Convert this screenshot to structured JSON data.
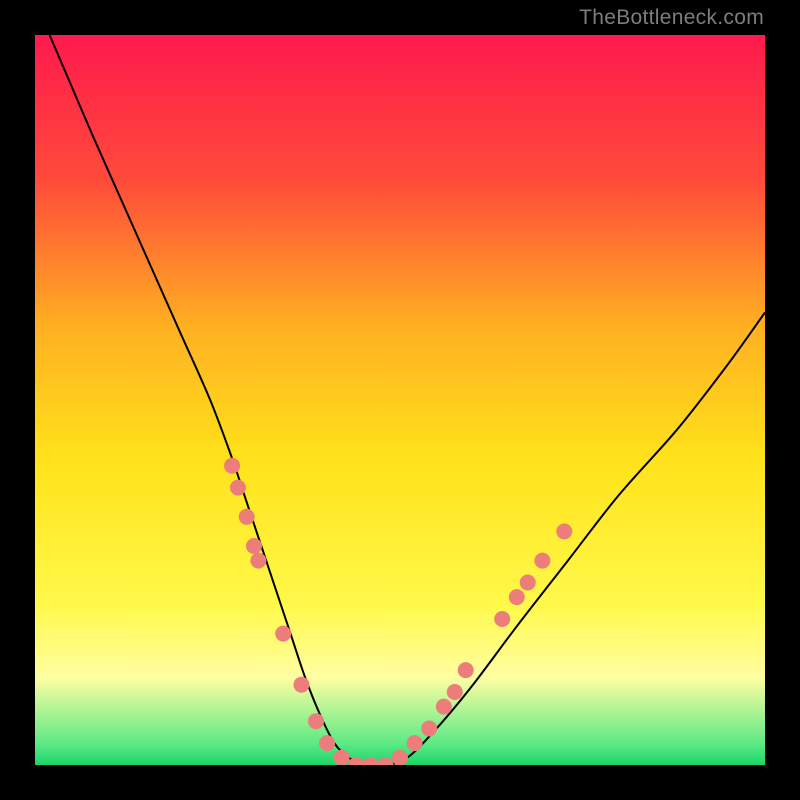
{
  "watermark": "TheBottleneck.com",
  "chart_data": {
    "type": "line",
    "title": "",
    "xlabel": "",
    "ylabel": "",
    "xlim": [
      0,
      100
    ],
    "ylim": [
      0,
      100
    ],
    "grid": false,
    "background": {
      "type": "vertical-gradient",
      "stops": [
        {
          "offset": 0.0,
          "color": "#ff1a4d"
        },
        {
          "offset": 0.2,
          "color": "#ff4b3a"
        },
        {
          "offset": 0.4,
          "color": "#ffb022"
        },
        {
          "offset": 0.58,
          "color": "#ffe21a"
        },
        {
          "offset": 0.78,
          "color": "#fff94a"
        },
        {
          "offset": 0.88,
          "color": "#fffea2"
        },
        {
          "offset": 0.97,
          "color": "#5eea85"
        },
        {
          "offset": 1.0,
          "color": "#1ad66a"
        }
      ]
    },
    "series": [
      {
        "name": "curve",
        "stroke": "#000000",
        "stroke_width": 2,
        "x": [
          2,
          5,
          8,
          12,
          16,
          20,
          24,
          27,
          29,
          31,
          33,
          35,
          37,
          39,
          41,
          43,
          45,
          48,
          51,
          55,
          60,
          66,
          73,
          80,
          88,
          95,
          100
        ],
        "y": [
          100,
          93,
          86,
          77,
          68,
          59,
          50,
          42,
          36,
          30,
          24,
          18,
          12,
          7,
          3,
          1,
          0,
          0,
          1,
          5,
          11,
          19,
          28,
          37,
          46,
          55,
          62
        ]
      }
    ],
    "markers": {
      "color": "#ec7d7a",
      "radius": 8,
      "points": [
        {
          "x": 27.0,
          "y": 41
        },
        {
          "x": 27.8,
          "y": 38
        },
        {
          "x": 29.0,
          "y": 34
        },
        {
          "x": 30.0,
          "y": 30
        },
        {
          "x": 30.6,
          "y": 28
        },
        {
          "x": 34.0,
          "y": 18
        },
        {
          "x": 36.5,
          "y": 11
        },
        {
          "x": 38.5,
          "y": 6
        },
        {
          "x": 40.0,
          "y": 3
        },
        {
          "x": 42.0,
          "y": 1
        },
        {
          "x": 44.0,
          "y": 0
        },
        {
          "x": 46.0,
          "y": 0
        },
        {
          "x": 48.0,
          "y": 0
        },
        {
          "x": 50.0,
          "y": 1
        },
        {
          "x": 52.0,
          "y": 3
        },
        {
          "x": 54.0,
          "y": 5
        },
        {
          "x": 56.0,
          "y": 8
        },
        {
          "x": 57.5,
          "y": 10
        },
        {
          "x": 59.0,
          "y": 13
        },
        {
          "x": 64.0,
          "y": 20
        },
        {
          "x": 66.0,
          "y": 23
        },
        {
          "x": 67.5,
          "y": 25
        },
        {
          "x": 69.5,
          "y": 28
        },
        {
          "x": 72.5,
          "y": 32
        }
      ]
    }
  }
}
